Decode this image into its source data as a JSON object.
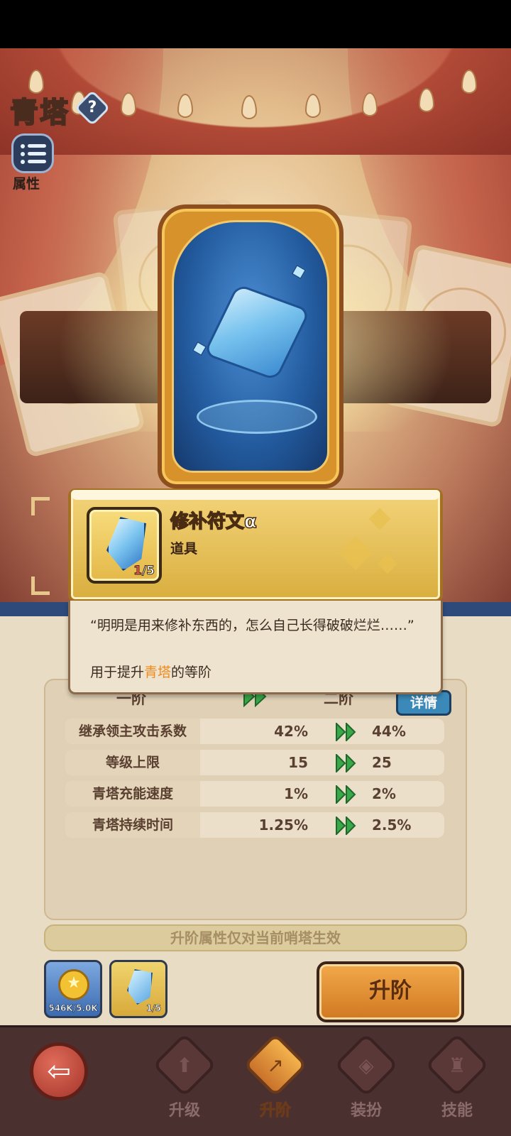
{
  "header": {
    "title": "青塔",
    "help": "?",
    "attr_label": "属性"
  },
  "popup": {
    "item_name": "修补符文α",
    "item_type": "道具",
    "count_current": "1",
    "count_total": "/5",
    "quote": "“明明是用来修补东西的，怎么自己长得破破烂烂……”",
    "use_prefix": "用于提升",
    "use_highlight": "青塔",
    "use_suffix": "的等阶"
  },
  "ranks": {
    "current": "一阶",
    "next": "二阶",
    "detail_button": "详情"
  },
  "stats": [
    {
      "name": "继承领主攻击系数",
      "old": "42%",
      "new": "44%"
    },
    {
      "name": "等级上限",
      "old": "15",
      "new": "25"
    },
    {
      "name": "青塔充能速度",
      "old": "1%",
      "new": "2%"
    },
    {
      "name": "青塔持续时间",
      "old": "1.25%",
      "new": "2.5%"
    }
  ],
  "notice": "升阶属性仅对当前哨塔生效",
  "costs": {
    "coin": "546K/5.0K",
    "rune": "1/5"
  },
  "upgrade_button": "升阶",
  "nav": [
    {
      "label": "升级",
      "icon": "upgrade-icon",
      "active": false
    },
    {
      "label": "升阶",
      "icon": "rank-up-icon",
      "active": true
    },
    {
      "label": "装扮",
      "icon": "costume-icon",
      "active": false
    },
    {
      "label": "技能",
      "icon": "skill-icon",
      "active": false
    }
  ],
  "colors": {
    "highlight": "#f08a1c",
    "gold": "#d9ae3e",
    "arrow": "#3aa74a"
  }
}
